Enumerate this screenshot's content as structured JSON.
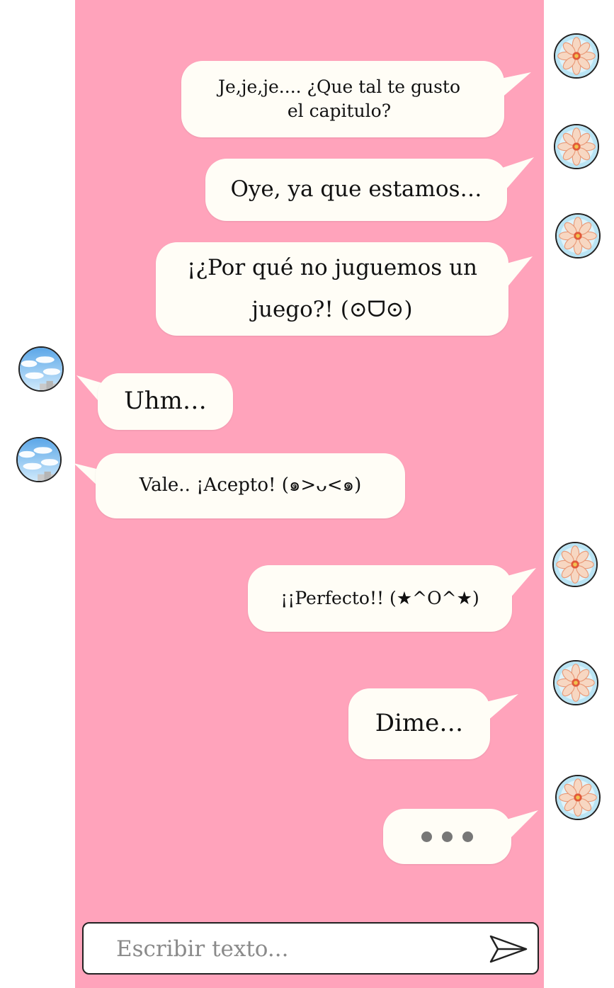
{
  "messages": [
    {
      "side": "right",
      "text": "Je,je,je....  ¿Que tal te gusto el capitulo?"
    },
    {
      "side": "right",
      "text": "Oye, ya que estamos…"
    },
    {
      "side": "right",
      "text": "¡¿Por qué no juguemos un juego?!  (⊙ᗜ⊙)"
    },
    {
      "side": "left",
      "text": "Uhm…"
    },
    {
      "side": "left",
      "text": "Vale.. ¡Acepto! (๑>ᴗ<๑)"
    },
    {
      "side": "right",
      "text": "¡¡Perfecto!! (★^O^★)"
    },
    {
      "side": "right",
      "text": "Dime…"
    },
    {
      "side": "right",
      "typing": true
    }
  ],
  "input": {
    "placeholder": "Escribir texto..."
  },
  "icons": {
    "right_avatar": "flower-avatar-icon",
    "left_avatar": "sky-avatar-icon",
    "send": "send-arrow-icon"
  },
  "colors": {
    "panel": "#ffa3bb",
    "bubble": "#fffdf6",
    "typing_dots": "#777777"
  }
}
